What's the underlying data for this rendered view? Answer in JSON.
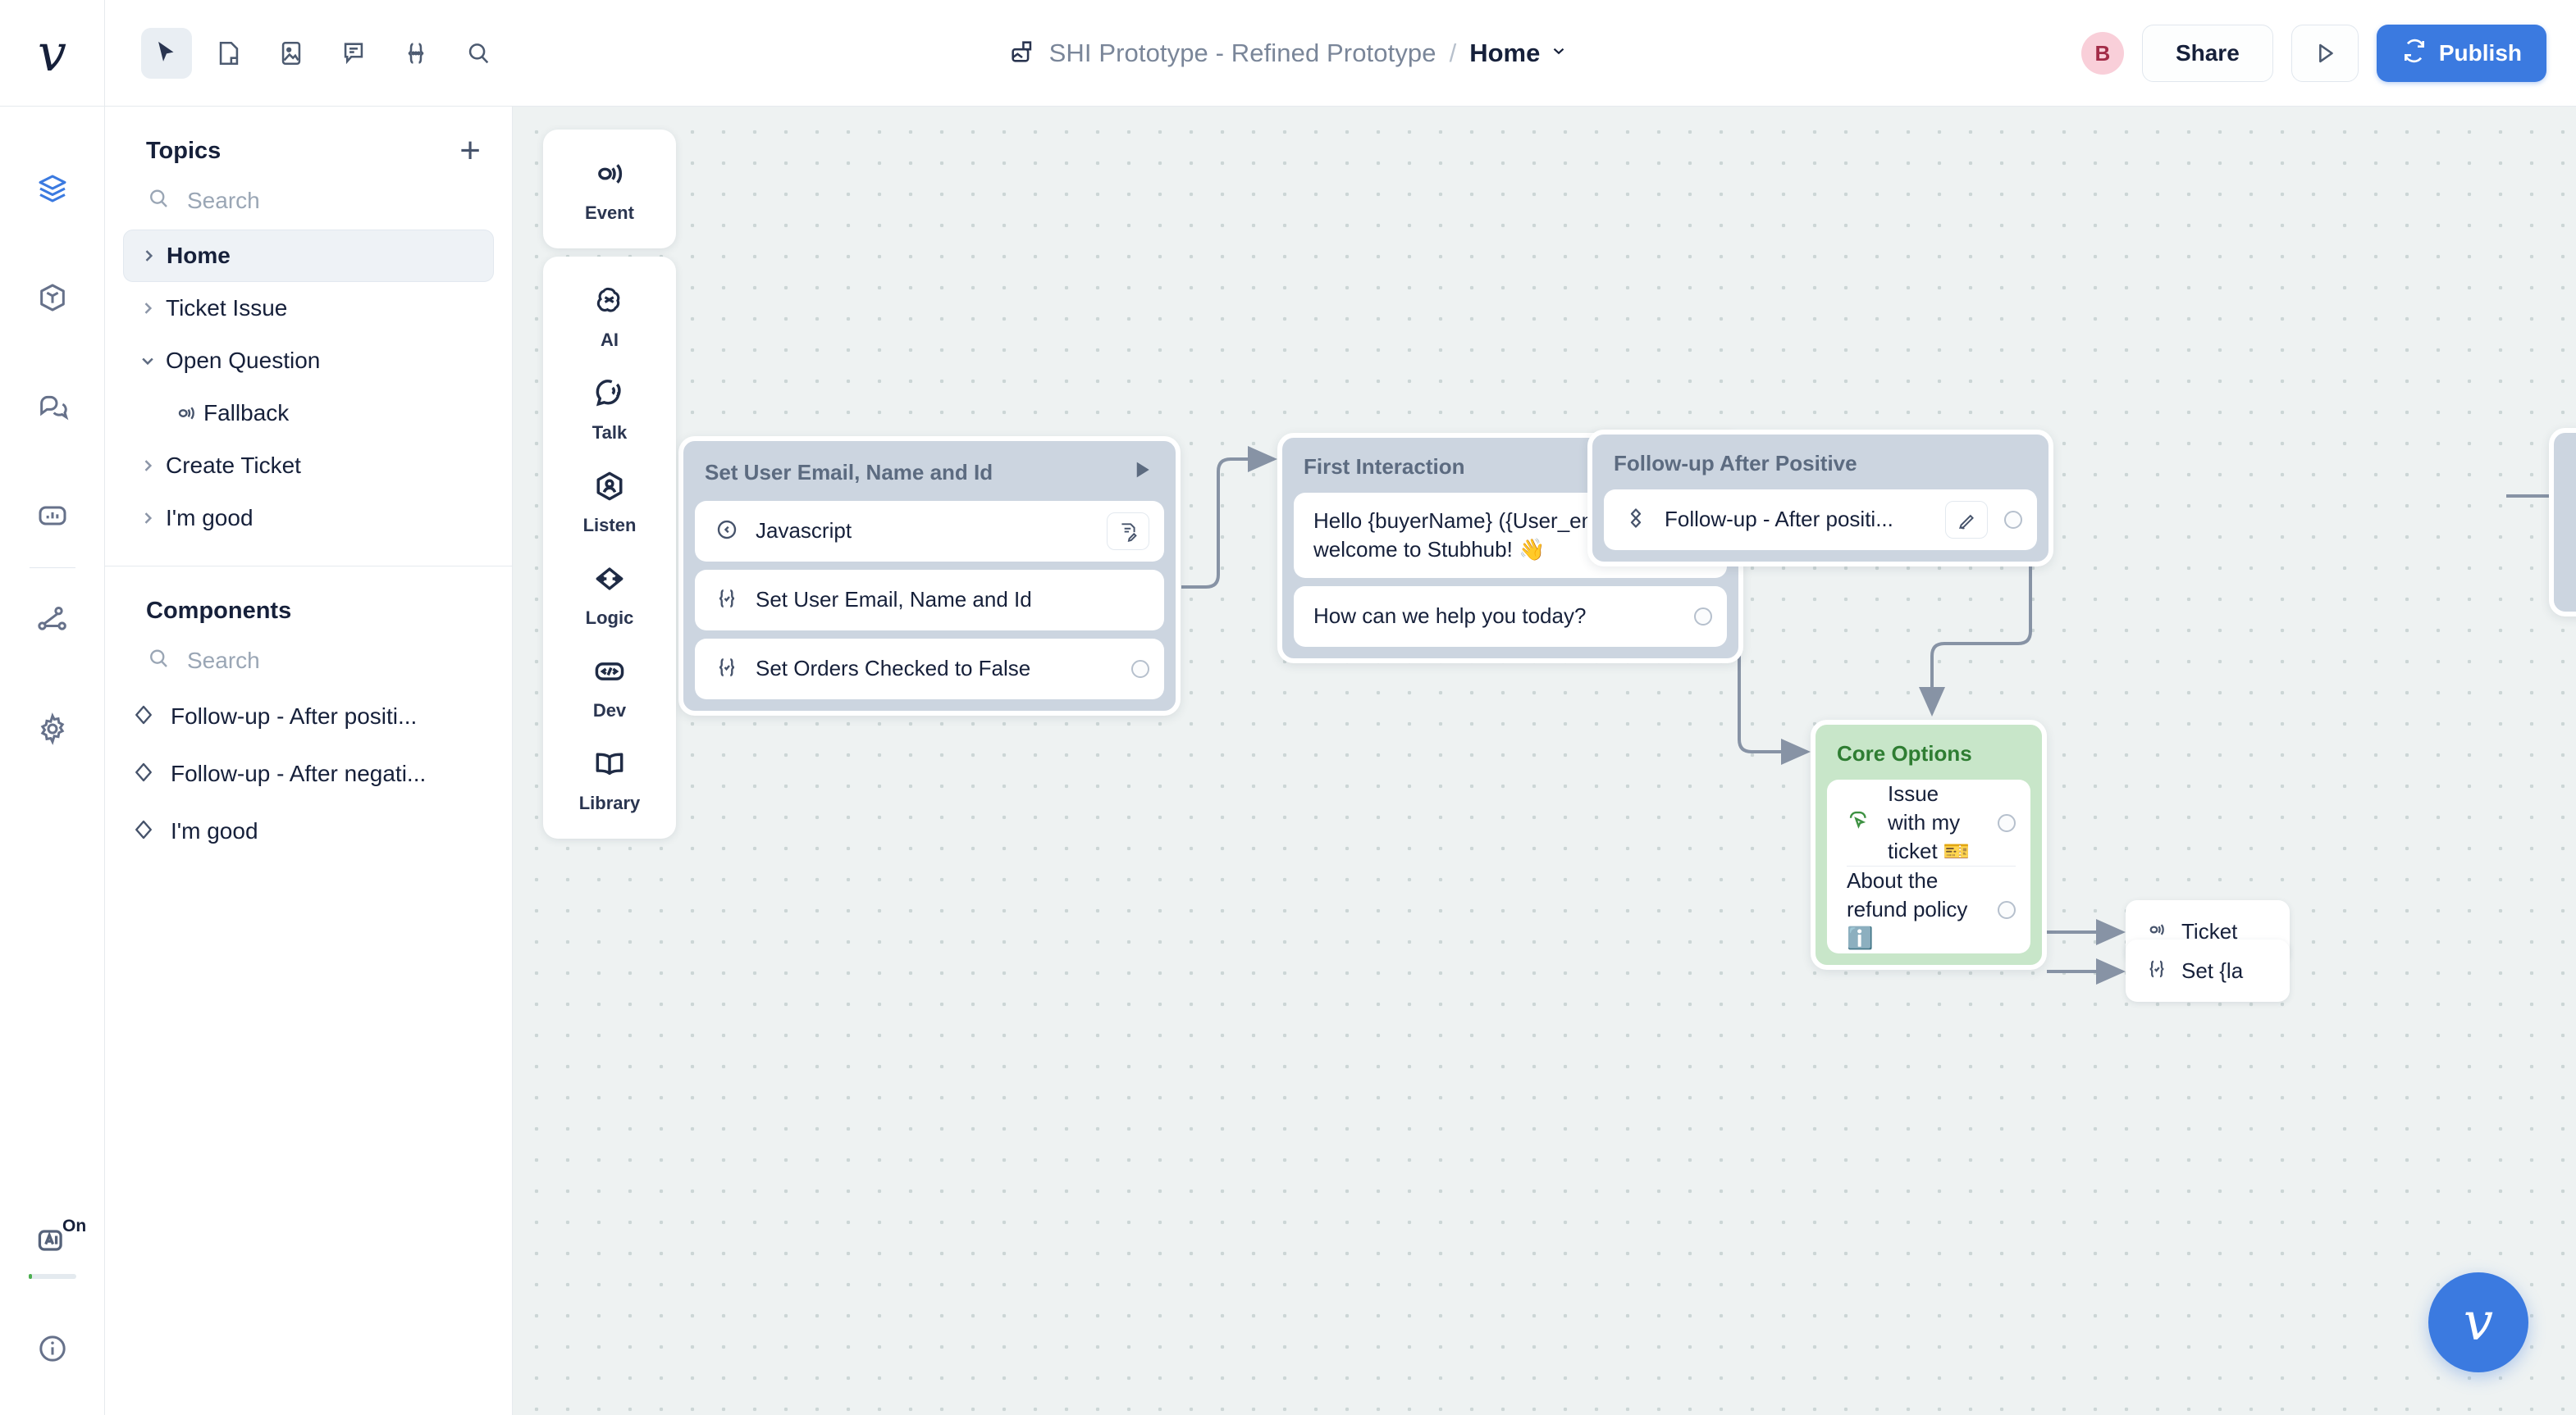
{
  "topbar": {
    "logo": "voiceflow-logo",
    "tools": [
      {
        "name": "cursor-tool",
        "icon": "cursor-icon",
        "active": true
      },
      {
        "name": "note-tool",
        "icon": "sticky-note-icon",
        "active": false
      },
      {
        "name": "image-tool",
        "icon": "image-icon",
        "active": false
      },
      {
        "name": "comment-tool",
        "icon": "comment-icon",
        "active": false
      },
      {
        "name": "variable-tool",
        "icon": "braces-icon",
        "active": false
      },
      {
        "name": "search-tool",
        "icon": "search-icon",
        "active": false
      }
    ],
    "breadcrumb": {
      "project": "SHI Prototype - Refined Prototype",
      "separator": "/",
      "current": "Home",
      "caret": "⌄"
    },
    "avatar_initial": "B",
    "share_label": "Share",
    "run_icon": "play-icon",
    "publish_label": "Publish",
    "publish_icon": "refresh-icon",
    "publish_color": "#3b7ae0"
  },
  "rail": {
    "items": [
      {
        "name": "sidebar-item-layers",
        "icon": "layers-icon",
        "active": true
      },
      {
        "name": "sidebar-item-components",
        "icon": "cube-icon",
        "active": false
      },
      {
        "name": "sidebar-item-conversations",
        "icon": "chat-bubbles-icon",
        "active": false
      },
      {
        "name": "sidebar-item-analytics",
        "icon": "analytics-icon",
        "active": false
      },
      {
        "name": "sidebar-item-integrations",
        "icon": "flow-nodes-icon",
        "active": false
      },
      {
        "name": "sidebar-item-settings",
        "icon": "gear-icon",
        "active": false
      }
    ],
    "ai_badge_label": "On",
    "ai_badge_icon": "ai-icon",
    "info_icon": "info-circle-icon"
  },
  "topics": {
    "title": "Topics",
    "add_icon": "plus-icon",
    "search_placeholder": "Search",
    "items": [
      {
        "label": "Home",
        "expanded": false,
        "selected": true,
        "child": false,
        "icon": "chevron-right-icon"
      },
      {
        "label": "Ticket Issue",
        "expanded": false,
        "selected": false,
        "child": false,
        "icon": "chevron-right-icon"
      },
      {
        "label": "Open Question",
        "expanded": true,
        "selected": false,
        "child": false,
        "icon": "chevron-down-icon"
      },
      {
        "label": "Fallback",
        "expanded": false,
        "selected": false,
        "child": true,
        "icon": "event-icon"
      },
      {
        "label": "Create Ticket",
        "expanded": false,
        "selected": false,
        "child": false,
        "icon": "chevron-right-icon"
      },
      {
        "label": "I'm good",
        "expanded": false,
        "selected": false,
        "child": false,
        "icon": "chevron-right-icon"
      }
    ]
  },
  "components": {
    "title": "Components",
    "search_placeholder": "Search",
    "items": [
      {
        "label": "Follow-up - After positi...",
        "icon": "component-diamond-icon"
      },
      {
        "label": "Follow-up - After negati...",
        "icon": "component-diamond-icon"
      },
      {
        "label": "I'm good",
        "icon": "component-diamond-icon"
      }
    ]
  },
  "palette": {
    "groups": [
      {
        "items": [
          {
            "label": "Event",
            "icon": "event-icon"
          }
        ]
      },
      {
        "items": [
          {
            "label": "AI",
            "icon": "ai-swirl-icon"
          },
          {
            "label": "Talk",
            "icon": "talk-bubble-icon"
          },
          {
            "label": "Listen",
            "icon": "listen-person-icon"
          },
          {
            "label": "Logic",
            "icon": "logic-arrows-icon"
          },
          {
            "label": "Dev",
            "icon": "code-icon"
          },
          {
            "label": "Library",
            "icon": "book-icon"
          }
        ]
      }
    ]
  },
  "canvas": {
    "nodes": [
      {
        "id": "set-user-email",
        "title": "Set User Email, Name and Id",
        "header_icon": "play-filled-icon",
        "color": "gray",
        "rows": [
          {
            "label": "Javascript",
            "icon": "javascript-icon",
            "action_icon": "edit-script-icon",
            "port": false
          },
          {
            "label": "Set User Email, Name and Id",
            "icon": "set-variable-icon",
            "port": false
          },
          {
            "label": "Set Orders Checked to False",
            "icon": "set-variable-icon",
            "port": true
          }
        ]
      },
      {
        "id": "first-interaction",
        "title": "First Interaction",
        "color": "gray",
        "rows": [
          {
            "label": "Hello {buyerName} ({User_email}), welcome to Stubhub! 👋",
            "port": false
          },
          {
            "label": "How can we help you today?",
            "port": true
          }
        ]
      },
      {
        "id": "follow-up-after-positive",
        "title": "Follow-up After Positive",
        "color": "gray",
        "rows": [
          {
            "label": "Follow-up - After positi...",
            "icon": "component-diamond-icon",
            "action_icon": "pencil-icon",
            "port": true
          }
        ]
      },
      {
        "id": "core-options",
        "title": "Core Options",
        "color": "green",
        "rows": [
          {
            "label": "Issue with my ticket 🎫",
            "icon": "choice-cursor-icon",
            "port": true
          },
          {
            "label": "About the refund policy ℹ️",
            "port": true
          }
        ]
      },
      {
        "id": "ticket-partial",
        "title": "Ticket",
        "color": "white",
        "icon": "event-icon"
      },
      {
        "id": "set-last-partial",
        "title": "Set {la",
        "color": "white",
        "icon": "set-variable-icon"
      }
    ],
    "fab_icon": "voiceflow-logo"
  }
}
